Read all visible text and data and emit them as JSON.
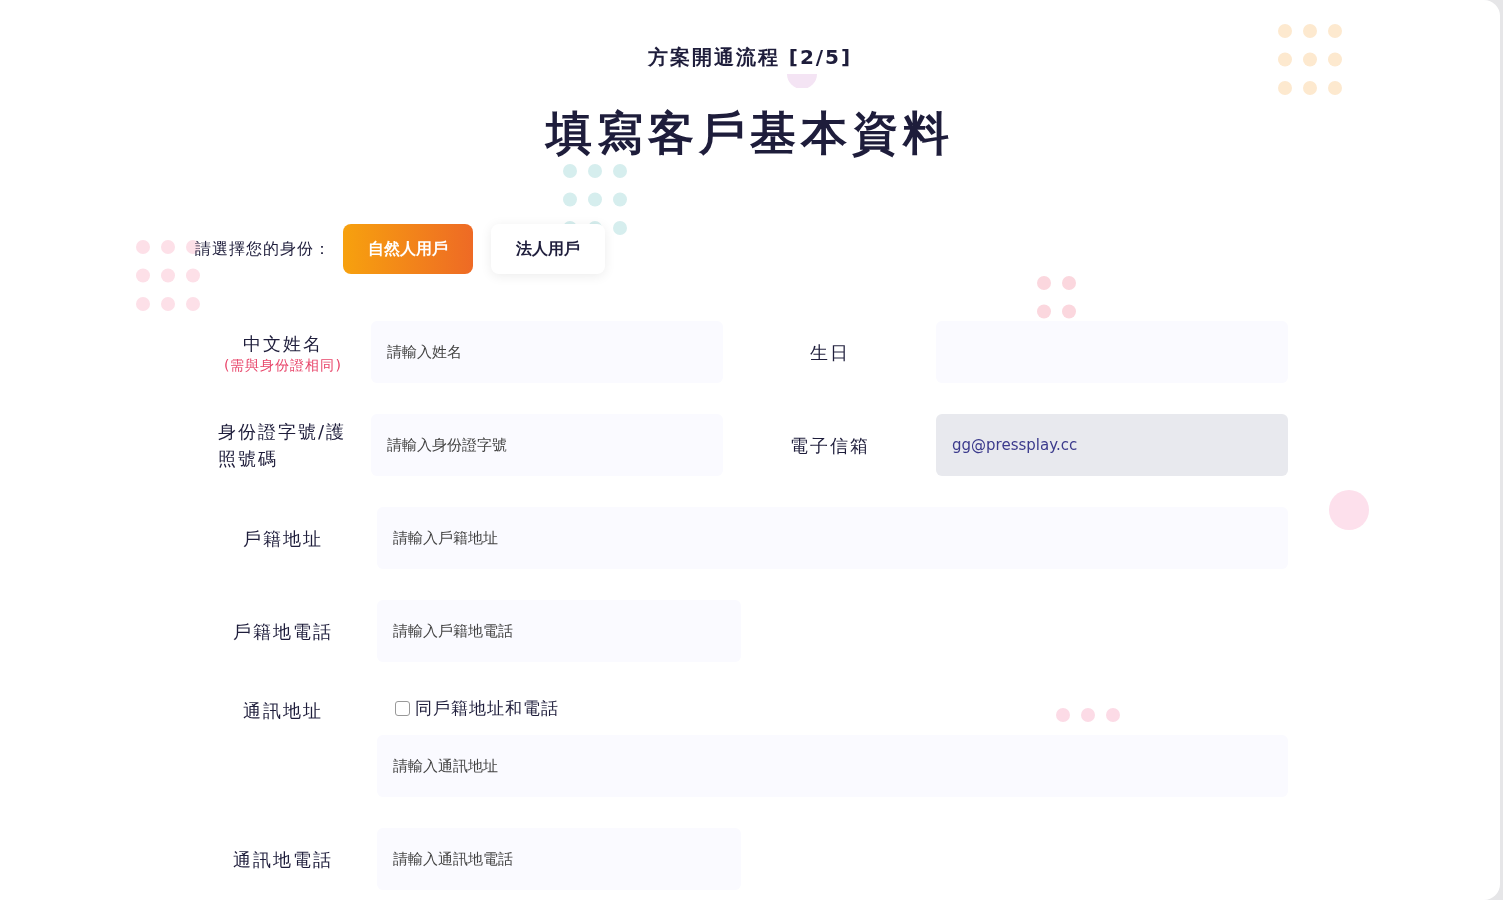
{
  "header": {
    "step": "方案開通流程 [2/5]",
    "title": "填寫客戶基本資料"
  },
  "identity": {
    "label": "請選擇您的身份：",
    "options": [
      {
        "label": "自然人用戶",
        "selected": true
      },
      {
        "label": "法人用戶",
        "selected": false
      }
    ]
  },
  "rows": [
    {
      "kind": "pair",
      "fields": [
        {
          "label": "中文姓名",
          "note": "(需與身份證相同)",
          "placeholder": "請輸入姓名",
          "disabled": false
        },
        {
          "label": "生日",
          "disabled": false
        }
      ]
    },
    {
      "kind": "pair",
      "fields": [
        {
          "label": "身份證字號/護照號碼",
          "placeholder": "請輸入身份證字號",
          "disabled": false
        },
        {
          "label": "電子信箱",
          "value": "gg@pressplay.cc",
          "disabled": true
        }
      ]
    },
    {
      "kind": "wide",
      "fields": [
        {
          "label": "戶籍地址",
          "placeholder": "請輸入戶籍地址",
          "disabled": false
        }
      ]
    },
    {
      "kind": "short",
      "fields": [
        {
          "label": "戶籍地電話",
          "placeholder": "請輸入戶籍地電話",
          "disabled": false
        }
      ]
    },
    {
      "kind": "checkbox_wide",
      "checkbox": {
        "label": "同戶籍地址和電話",
        "checked": false
      },
      "fields": [
        {
          "label": "通訊地址",
          "placeholder": "請輸入通訊地址",
          "disabled": false
        }
      ]
    },
    {
      "kind": "short",
      "fields": [
        {
          "label": "通訊地電話",
          "placeholder": "請輸入通訊地電話",
          "disabled": false
        }
      ]
    }
  ]
}
